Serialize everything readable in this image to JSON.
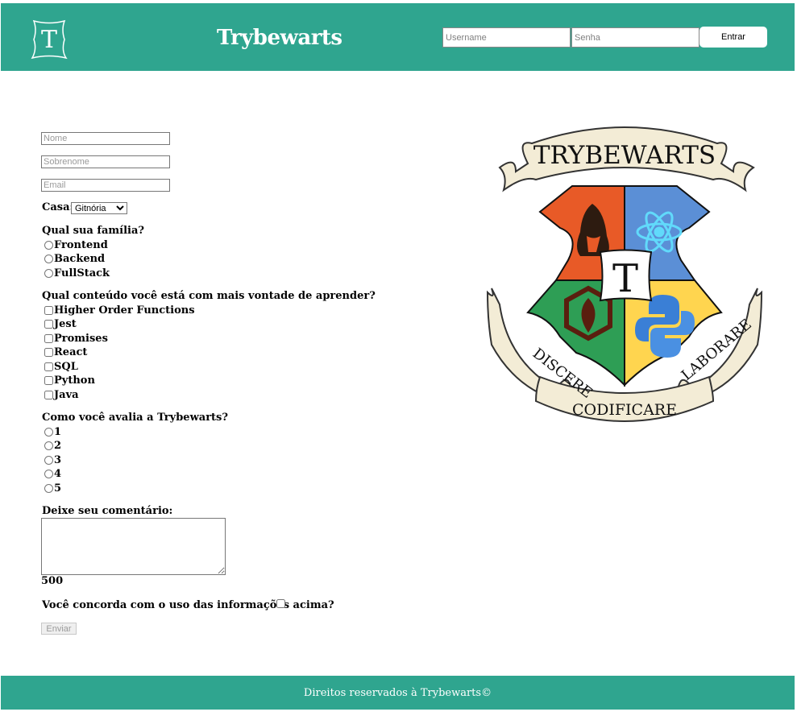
{
  "header": {
    "logo_letter": "T",
    "title": "Trybewarts",
    "username_placeholder": "Username",
    "password_placeholder": "Senha",
    "login_button": "Entrar"
  },
  "form": {
    "name_placeholder": "Nome",
    "lastname_placeholder": "Sobrenome",
    "email_placeholder": "Email",
    "house_label": "Casa:",
    "house_selected": "Gitnória",
    "family_question": "Qual sua família?",
    "family_options": [
      "Frontend",
      "Backend",
      "FullStack"
    ],
    "content_question": "Qual conteúdo você está com mais vontade de aprender?",
    "content_options": [
      "Higher Order Functions",
      "Jest",
      "Promises",
      "React",
      "SQL",
      "Python",
      "Java"
    ],
    "rating_question": "Como você avalia a Trybewarts?",
    "rating_options": [
      "1",
      "2",
      "3",
      "4",
      "5"
    ],
    "comment_label": "Deixe seu comentário:",
    "comment_value": "",
    "char_counter": "500",
    "agreement_label": "Você concorda com o uso das informações acima?",
    "submit_label": "Enviar"
  },
  "crest": {
    "banner_top": "TRYBEWARTS",
    "banner_left": "DISCERE",
    "banner_bottom": "CODIFICARE",
    "banner_right": "LABORARE",
    "center_letter": "T",
    "quadrant_colors": [
      "#e85a27",
      "#5b8fd6",
      "#2e9e55",
      "#ffd54f"
    ]
  },
  "footer": {
    "text": "Direitos reservados à Trybewarts©"
  }
}
